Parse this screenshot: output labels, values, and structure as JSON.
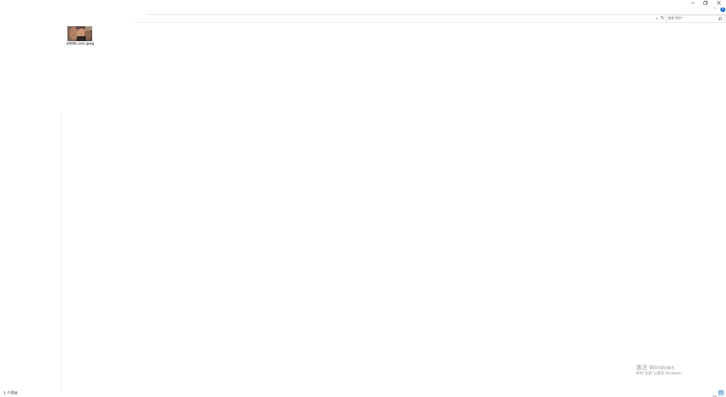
{
  "window_controls": {
    "minimize": "–",
    "restore": "❐",
    "close": "✕"
  },
  "help": {
    "chevron": "⌃",
    "label": "?"
  },
  "address_bar": {
    "dropdown": "⌄",
    "refresh": "↻"
  },
  "search": {
    "placeholder": "搜索\"图片\""
  },
  "files": [
    {
      "name": "of996.com.jpeg",
      "icon": "image-thumbnail"
    }
  ],
  "status": {
    "item_count": "1 个项目"
  },
  "watermark": {
    "title": "激活 Windows",
    "subtitle": "转到\"设置\"以激活 Windows。"
  },
  "colors": {
    "accent": "#1f6fd1",
    "selected_view": "#cce4f7"
  }
}
